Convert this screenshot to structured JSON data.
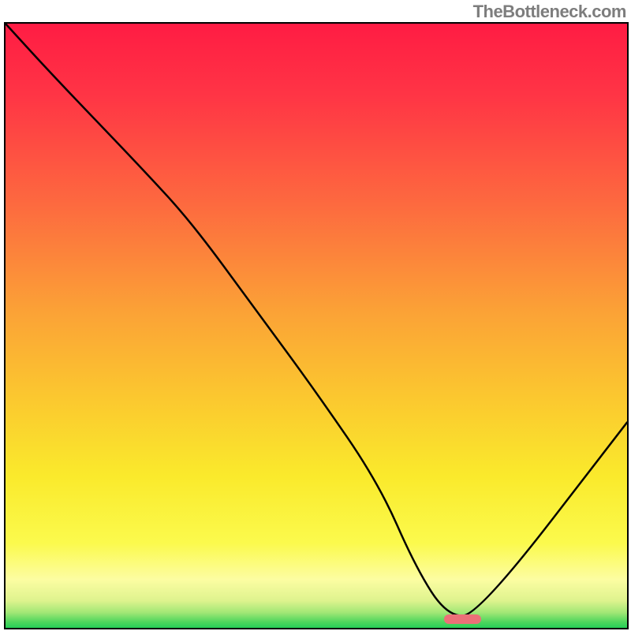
{
  "attribution": "TheBottleneck.com",
  "colors": {
    "frame_border": "#000000",
    "curve": "#000000",
    "marker": "#ec7078",
    "gradient_stops": [
      {
        "offset": 0.0,
        "color": "#ff1c44"
      },
      {
        "offset": 0.12,
        "color": "#ff3545"
      },
      {
        "offset": 0.3,
        "color": "#fd6a3f"
      },
      {
        "offset": 0.48,
        "color": "#fba336"
      },
      {
        "offset": 0.62,
        "color": "#fbc82f"
      },
      {
        "offset": 0.75,
        "color": "#faea2c"
      },
      {
        "offset": 0.86,
        "color": "#fbfa4d"
      },
      {
        "offset": 0.92,
        "color": "#fcfda2"
      },
      {
        "offset": 0.955,
        "color": "#def38e"
      },
      {
        "offset": 0.975,
        "color": "#a0e775"
      },
      {
        "offset": 0.99,
        "color": "#4fd65d"
      },
      {
        "offset": 1.0,
        "color": "#26cf58"
      }
    ]
  },
  "chart_data": {
    "type": "line",
    "title": "",
    "xlabel": "",
    "ylabel": "",
    "xlim": [
      0,
      100
    ],
    "ylim": [
      0,
      100
    ],
    "categories": [
      0,
      8,
      22,
      30,
      40,
      50,
      60,
      66,
      71,
      76,
      100
    ],
    "series": [
      {
        "name": "bottleneck-curve",
        "values": [
          100,
          91,
          76,
          67,
          53,
          39,
          24,
          10,
          2,
          2,
          34
        ]
      }
    ],
    "annotations": [
      {
        "name": "optimal-region-marker",
        "x0": 70.5,
        "x1": 76.5,
        "y": 1.5
      }
    ]
  }
}
